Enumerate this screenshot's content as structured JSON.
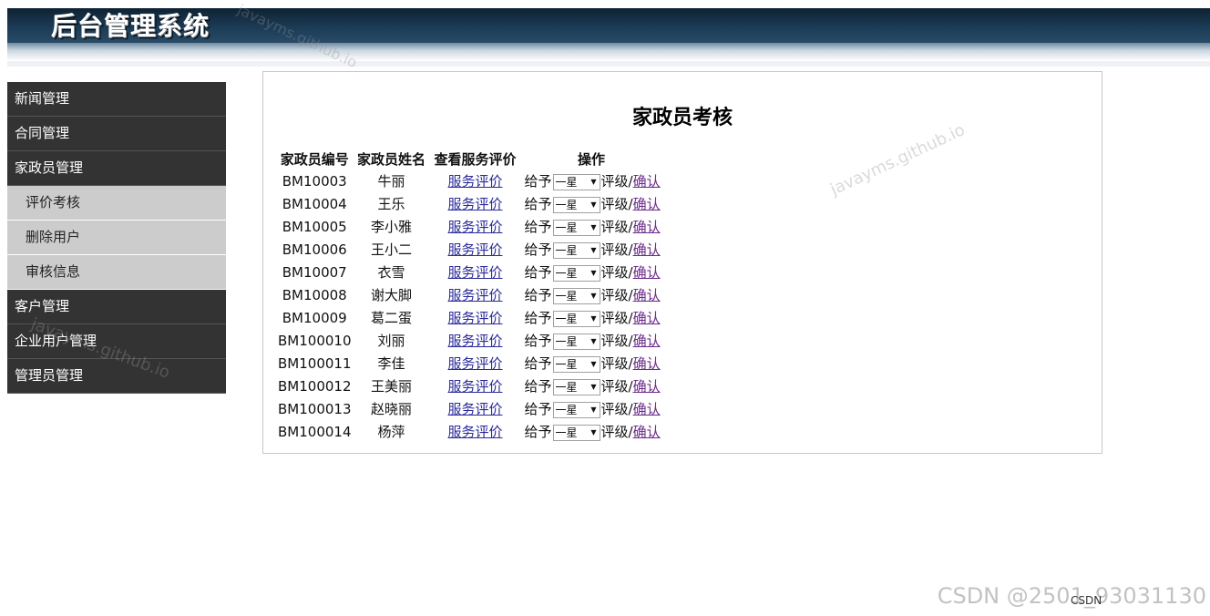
{
  "app": {
    "title": "后台管理系统"
  },
  "sidebar": {
    "items": [
      {
        "label": "新闻管理",
        "type": "top"
      },
      {
        "label": "合同管理",
        "type": "top"
      },
      {
        "label": "家政员管理",
        "type": "top"
      },
      {
        "label": "评价考核",
        "type": "sub"
      },
      {
        "label": "删除用户",
        "type": "sub"
      },
      {
        "label": "审核信息",
        "type": "sub"
      },
      {
        "label": "客户管理",
        "type": "top"
      },
      {
        "label": "企业用户管理",
        "type": "top"
      },
      {
        "label": "管理员管理",
        "type": "top"
      }
    ]
  },
  "main": {
    "title": "家政员考核",
    "columns": [
      "家政员编号",
      "家政员姓名",
      "查看服务评价",
      "操作"
    ],
    "op_prefix": "给予",
    "op_suffix": "评级/",
    "confirm_label": "确认",
    "eval_label": "服务评价",
    "default_rating": "一星",
    "rows": [
      {
        "id": "BM10003",
        "name": "牛丽"
      },
      {
        "id": "BM10004",
        "name": "王乐"
      },
      {
        "id": "BM10005",
        "name": "李小雅"
      },
      {
        "id": "BM10006",
        "name": "王小二"
      },
      {
        "id": "BM10007",
        "name": "衣雪"
      },
      {
        "id": "BM10008",
        "name": "谢大脚"
      },
      {
        "id": "BM10009",
        "name": "葛二蛋"
      },
      {
        "id": "BM100010",
        "name": "刘丽"
      },
      {
        "id": "BM100011",
        "name": "李佳"
      },
      {
        "id": "BM100012",
        "name": "王美丽"
      },
      {
        "id": "BM100013",
        "name": "赵晓丽"
      },
      {
        "id": "BM100014",
        "name": "杨萍"
      }
    ]
  },
  "watermarks": {
    "site": "javayms.github.io",
    "csdn": "CSDN @2501_93031130",
    "csdn_small": "CSDN"
  },
  "icons": {
    "dropdown": "chevron-down-icon"
  }
}
